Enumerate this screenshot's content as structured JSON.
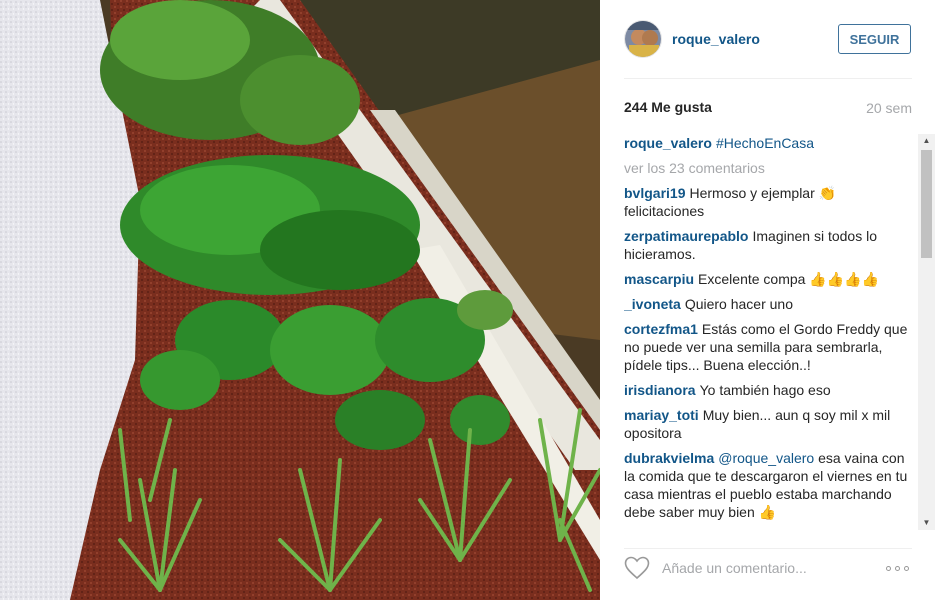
{
  "post": {
    "username": "roque_valero",
    "follow_label": "SEGUIR",
    "likes": "244 Me gusta",
    "time_ago": "20 sem",
    "caption": {
      "author": "roque_valero",
      "text": "#HechoEnCasa"
    },
    "view_all_comments": "ver los 23 comentarios",
    "comments": [
      {
        "author": "bvlgari19",
        "text": "Hermoso y ejemplar 👏 felicitaciones"
      },
      {
        "author": "zerpatimaurepablo",
        "text": "Imaginen si todos lo hicieramos."
      },
      {
        "author": "mascarpiu",
        "text": "Excelente compa 👍👍👍👍"
      },
      {
        "author": "_ivoneta",
        "text": "Quiero hacer uno"
      },
      {
        "author": "cortezfma1",
        "text": "Estás como el Gordo Freddy que no puede ver una semilla para sembrarla, pídele tips... Buena elección..!"
      },
      {
        "author": "irisdianora",
        "text": "Yo también hago eso"
      },
      {
        "author": "mariay_toti",
        "text": "Muy bien... aun q soy mil x mil opositora"
      },
      {
        "author": "dubrakvielma",
        "mention": "@roque_valero",
        "text": "esa vaina con la comida que te descargaron el viernes en tu casa mientras el pueblo estaba marchando debe saber muy bien 👍"
      }
    ],
    "comment_placeholder": "Añade un comentario...",
    "icons": {
      "like": "heart-outline-icon",
      "more": "more-options-icon"
    }
  },
  "colors": {
    "link_blue": "#125688",
    "follow_border": "#3f729b",
    "muted_gray": "#a5a7aa"
  }
}
